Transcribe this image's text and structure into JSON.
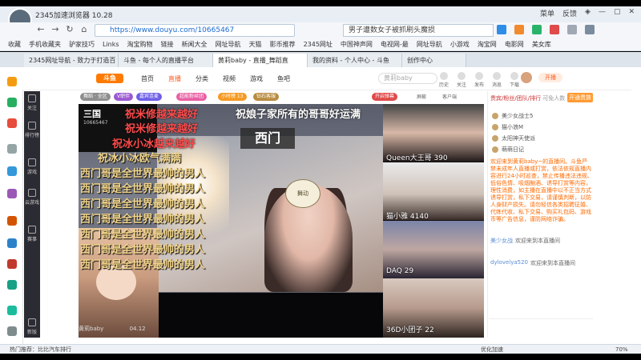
{
  "browser": {
    "app_title": "2345加速浏览器 10.28",
    "window_buttons": [
      "菜单",
      "反馈",
      "皮肤",
      "最小化",
      "最大化",
      "关闭"
    ],
    "url": "https://www.douyu.com/10665467",
    "search_text": "男子遭数女子被抓刷头魔损",
    "bookmarks": [
      "收藏",
      "手机收藏夹",
      "驴家技巧",
      "Links",
      "淘宝购物",
      "链接",
      "新闻大全",
      "网址导航",
      "天猫",
      "影币推荐",
      "2345网址",
      "中国神声网",
      "电视网-最",
      "网址导航",
      "小游戏",
      "淘宝网",
      "电影网",
      "美女库"
    ],
    "tabs": [
      {
        "label": "2345网址导航 - 致力于打造百"
      },
      {
        "label": "斗鱼 - 每个人的直播平台"
      },
      {
        "label": "黄莉baby - 直播_舞蹈直"
      },
      {
        "label": "我的资料 - 个人中心 - 斗鱼"
      },
      {
        "label": "创作中心"
      }
    ],
    "status_left": "热门推荐：比比汽车排行",
    "status_right": "优化加速",
    "zoom": "70%"
  },
  "site": {
    "logo": "斗鱼",
    "nav": [
      "首页",
      "直播",
      "分类",
      "视频",
      "游戏",
      "鱼吧"
    ],
    "active_nav": "直播",
    "search_placeholder": "黄莉baby",
    "user_icons": [
      "历史",
      "关注",
      "发布",
      "消息",
      "下载"
    ],
    "open_button": "开播"
  },
  "left_sidebar_rail": [
    "关注",
    "排行榜",
    "游戏",
    "云游戏",
    "赛事",
    "新版"
  ],
  "room": {
    "badges": [
      {
        "label": "舞蹈 · 全区",
        "color": "#8e8e8e"
      },
      {
        "label": "V职伴",
        "color": "#9b59d0"
      },
      {
        "label": "嘉宾连麦",
        "color": "#6d5ee7"
      },
      {
        "label": "超能粉丝团",
        "color": "#e95fa3"
      },
      {
        "label": "小时榜 13",
        "color": "#f59a23"
      },
      {
        "label": "钻石客服",
        "color": "#b88b3f"
      }
    ],
    "header_right": [
      "开启弹幕",
      "屏蔽",
      "客户端"
    ]
  },
  "video": {
    "corner_logo": "三国",
    "corner_sub": "10665467",
    "center_tag": "西门",
    "mascot_text": "舞动",
    "danmaku_top": [
      {
        "text": "祝米修越来越好",
        "style": "r"
      },
      {
        "text": "祝娘子家所有的哥哥好运满",
        "style": "w"
      },
      {
        "text": "祝米修越来越好",
        "style": "r"
      },
      {
        "text": "祝冰小冰越来越好",
        "style": "r"
      },
      {
        "text": "祝冰小冰欧气满满",
        "style": "y"
      }
    ],
    "danmaku_repeat": [
      "西门哥是全世界最帅的男人",
      "西门哥是全世界最帅的男人",
      "西门哥是全世界最帅的男人",
      "西门哥是全世界最帅的男人",
      "西门哥是全世界最帅的男人",
      "西门哥是全世界最帅的男人",
      "西门哥是全世界最帅的男人"
    ],
    "footer_watermark": "黄莉baby",
    "footer_date": "04.12"
  },
  "guests": [
    {
      "name": "Queen大王哥",
      "value": "390"
    },
    {
      "name": "猫小雅",
      "value": "4140"
    },
    {
      "name": "DAQ",
      "value": "29"
    },
    {
      "name": "36D小团子",
      "value": "22"
    }
  ],
  "chat": {
    "tab_label": "贵宾/粉丝/团队/排行",
    "tab_sub": "可免人数",
    "open_vip": "开通贵族",
    "rank": [
      "美少女战士5",
      "猫小浪M",
      "太阳神天使派",
      "萌萌日记"
    ],
    "notice": "欢迎来到黄莉baby~的直播间。斗鱼严禁未成年人直播或打赏，依法依规直播内容进行24小时巡查，禁止传播违法违规、低俗色情、吸烟酗酒、诱导打赏等内容，理性消费，如主播在直播中以不正当方式诱导打赏，私下交易，请谨慎判断，以防人身财产损失。请勿轻信各类招聘征婚、代练代收、私下交易、购买礼包码、游戏币等广告信息，谨防网络诈骗。",
    "lines": [
      {
        "user": "美少女战",
        "text": "欢迎来到本直播间"
      },
      {
        "user": "dylovelya520",
        "text": "欢迎来到本直播间"
      }
    ]
  }
}
